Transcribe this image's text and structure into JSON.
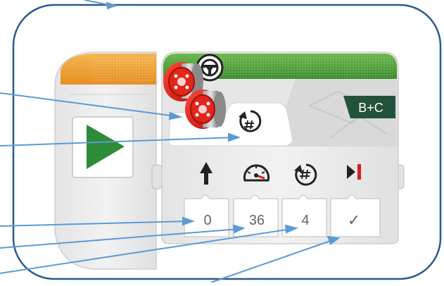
{
  "block": {
    "port": "B+C",
    "parameters": [
      {
        "name": "direction",
        "icon": "arrow-up-icon",
        "value": "0"
      },
      {
        "name": "speed",
        "icon": "speedometer-icon",
        "value": "36"
      },
      {
        "name": "rotations",
        "icon": "rotations-icon",
        "value": "4"
      },
      {
        "name": "brake",
        "icon": "stop-icon",
        "value": "✓"
      }
    ],
    "mode_icon": "rotations-icon"
  },
  "colors": {
    "frame": "#2b5a8c",
    "callout_line": "#5b9bd5",
    "header_green": "#5aa541",
    "start_orange": "#f0a53a",
    "play_green": "#2e8b38"
  }
}
